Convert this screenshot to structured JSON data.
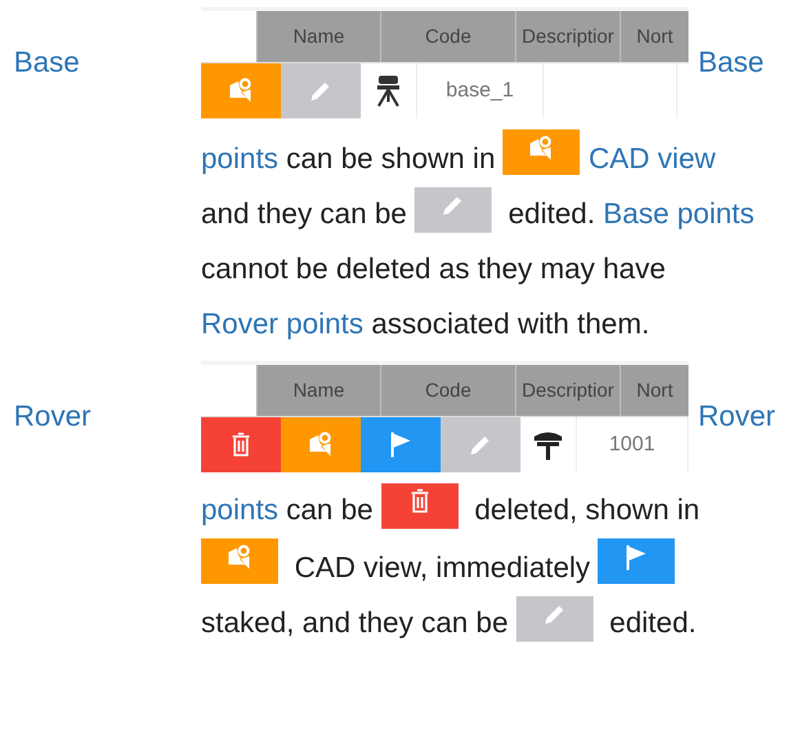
{
  "sections": [
    {
      "term_left": "Base",
      "term_right": "Base",
      "table": {
        "columns": [
          "Name",
          "Code",
          "Descriptior",
          "Nort"
        ],
        "cells": [
          {
            "kind": "cad"
          },
          {
            "kind": "edit"
          },
          {
            "kind": "base_instrument"
          },
          {
            "kind": "text",
            "text": "base_1"
          },
          {
            "kind": "empty"
          }
        ]
      },
      "paragraph": [
        {
          "kind": "link",
          "text": "points"
        },
        {
          "kind": "text",
          "text": " can be shown in "
        },
        {
          "kind": "cad"
        },
        {
          "kind": "link",
          "text": "CAD view"
        },
        {
          "kind": "text",
          "text": " and they can be "
        },
        {
          "kind": "edit"
        },
        {
          "kind": "text",
          "text": " edited. "
        },
        {
          "kind": "link",
          "text": "Base points"
        },
        {
          "kind": "text",
          "text": " cannot be deleted as they may have "
        },
        {
          "kind": "link",
          "text": "Rover points"
        },
        {
          "kind": "text",
          "text": " associated with them."
        }
      ]
    },
    {
      "term_left": "Rover",
      "term_right": "Rover",
      "table": {
        "columns": [
          "Name",
          "Code",
          "Descriptior",
          "Nort"
        ],
        "cells": [
          {
            "kind": "delete"
          },
          {
            "kind": "cad"
          },
          {
            "kind": "stake"
          },
          {
            "kind": "edit"
          },
          {
            "kind": "rover_instrument"
          },
          {
            "kind": "text",
            "text": "1001"
          }
        ]
      },
      "paragraph": [
        {
          "kind": "link",
          "text": "points"
        },
        {
          "kind": "text",
          "text": " can be "
        },
        {
          "kind": "delete"
        },
        {
          "kind": "text",
          "text": " deleted, shown in "
        },
        {
          "kind": "cad"
        },
        {
          "kind": "text",
          "text": " CAD view, immediately "
        },
        {
          "kind": "stake"
        },
        {
          "kind": "text",
          "text": " staked, and they can be "
        },
        {
          "kind": "edit"
        },
        {
          "kind": "text",
          "text": " edited."
        }
      ]
    }
  ]
}
